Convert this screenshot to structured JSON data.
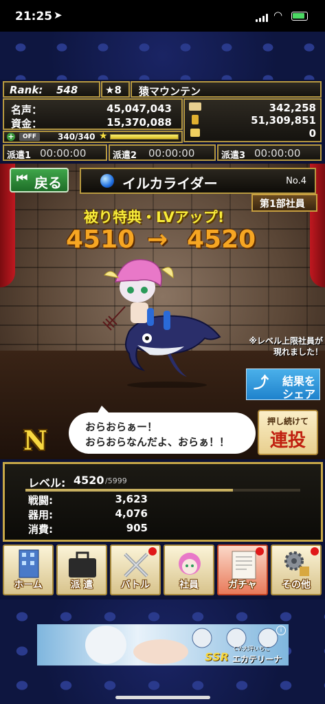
{
  "status": {
    "time": "21:25"
  },
  "profile": {
    "rank_label": "Rank:",
    "rank": "548",
    "stars": "★8",
    "company": "猿マウンテン",
    "fame_label": "名声：",
    "fame": "45,047,043",
    "funds_label": "資金：",
    "funds": "15,370,088",
    "resource1": "342,258",
    "resource2": "51,309,851",
    "resource3": "0",
    "toggle": "OFF",
    "stamina": "340/340"
  },
  "dispatch": [
    {
      "label": "派遣1",
      "time": "00:00:00"
    },
    {
      "label": "派遣2",
      "time": "00:00:00"
    },
    {
      "label": "派遣3",
      "time": "00:00:00"
    }
  ],
  "header": {
    "back": "戻る",
    "name": "イルカライダー",
    "no": "No.4",
    "dept": "第1部社員"
  },
  "result": {
    "title": "被り特典・LVアップ!",
    "from": "4510",
    "arrow": "→",
    "to": "4520"
  },
  "notice": {
    "line1": "※レベル上限社員が",
    "line2": "現れました！"
  },
  "share": {
    "line1": "結果を",
    "line2": "シェア"
  },
  "rapid": {
    "small": "押し続けて",
    "big": "連投"
  },
  "rarity": "N",
  "speech": {
    "line1": "おらおらぁー！",
    "line2": "おらおらなんだよ、おらぁ！！"
  },
  "stats": {
    "level_label": "レベル:",
    "level": "4520",
    "level_max": "/5999",
    "level_progress": 0.754,
    "rows": [
      {
        "label": "戦闘:",
        "value": "3,623"
      },
      {
        "label": "器用:",
        "value": "4,076"
      },
      {
        "label": "消費:",
        "value": "905"
      }
    ]
  },
  "nav": [
    {
      "label": "ホーム",
      "icon": "building-icon"
    },
    {
      "label": "派 遣",
      "icon": "briefcase-icon"
    },
    {
      "label": "バトル",
      "icon": "swords-icon"
    },
    {
      "label": "社員",
      "icon": "employee-icon"
    },
    {
      "label": "ガチャ",
      "icon": "gacha-document-icon"
    },
    {
      "label": "その他",
      "icon": "gear-icon"
    }
  ],
  "ad": {
    "badge": "SSR",
    "name": "エカテリーナ",
    "cv": "CV:大坪いちこ"
  }
}
